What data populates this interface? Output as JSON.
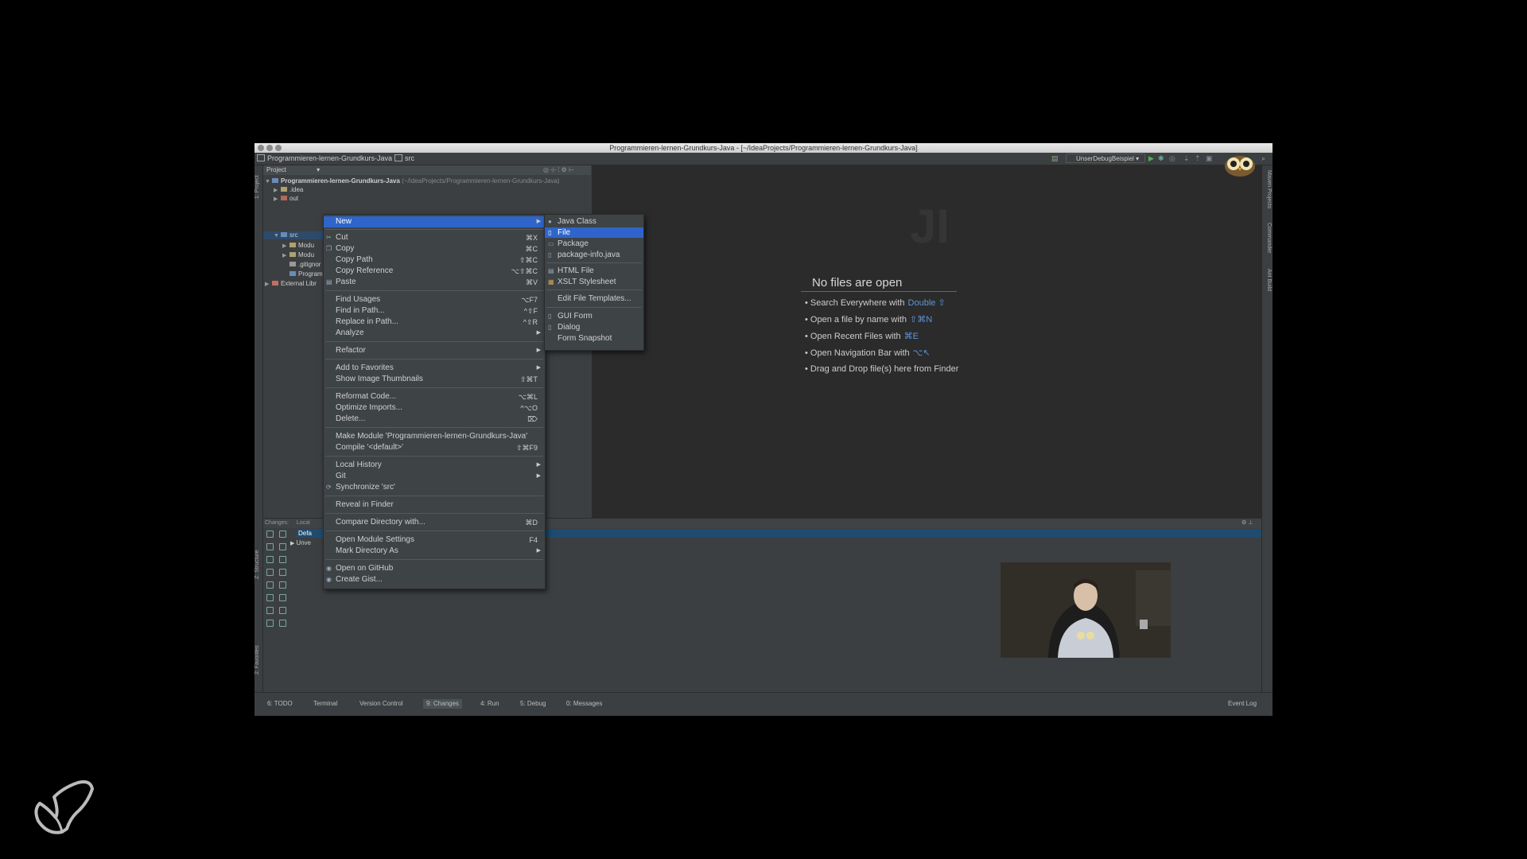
{
  "window": {
    "title": "Programmieren-lernen-Grundkurs-Java - [~/IdeaProjects/Programmieren-lernen-Grundkurs-Java]"
  },
  "navbar": {
    "project": "Programmieren-lernen-Grundkurs-Java",
    "folder": "src",
    "run_config": "UnserDebugBeispiel"
  },
  "left_strip": {
    "project_tab": "1: Project",
    "structure_tab": "Z: Structure",
    "favorites_tab": "2: Favorites"
  },
  "right_strip": {
    "maven": "Maven Projects",
    "commander": "Commander",
    "ant": "Ant Build"
  },
  "project_panel": {
    "header": "Project",
    "tree": [
      {
        "label": "Programmieren-lernen-Grundkurs-Java",
        "hint": "(~/IdeaProjects/Programmieren-lernen-Grundkurs-Java)"
      },
      {
        "label": ".idea"
      },
      {
        "label": "out"
      },
      {
        "label": "src"
      },
      {
        "label": "Modu"
      },
      {
        "label": "Modu"
      },
      {
        "label": ".gitignor"
      },
      {
        "label": "Program"
      },
      {
        "label": "External Libr"
      }
    ]
  },
  "editor": {
    "logo": "JI",
    "empty_title": "No files are open",
    "tips": [
      {
        "text": "Search Everywhere with",
        "key": "Double ⇧"
      },
      {
        "text": "Open a file by name with",
        "key": "⇧⌘N"
      },
      {
        "text": "Open Recent Files with",
        "key": "⌘E"
      },
      {
        "text": "Open Navigation Bar with",
        "key": "⌥↖"
      },
      {
        "text": "Drag and Drop file(s) here from Finder",
        "key": ""
      }
    ]
  },
  "bottom_panel": {
    "tab_changes": "Changes:",
    "tab_local": "Local",
    "row_default": "Defa",
    "row_unversioned": "Unve"
  },
  "context_menu": {
    "items": [
      {
        "label": "New",
        "shortcut": "",
        "submenu": true,
        "highlighted": true
      },
      {
        "label": "Cut",
        "shortcut": "⌘X",
        "icon": "cut-icon"
      },
      {
        "label": "Copy",
        "shortcut": "⌘C",
        "icon": "copy-icon"
      },
      {
        "label": "Copy Path",
        "shortcut": "⇧⌘C"
      },
      {
        "label": "Copy Reference",
        "shortcut": "⌥⇧⌘C"
      },
      {
        "label": "Paste",
        "shortcut": "⌘V",
        "icon": "paste-icon"
      },
      {
        "label": "Find Usages",
        "shortcut": "⌥F7"
      },
      {
        "label": "Find in Path...",
        "shortcut": "^⇧F"
      },
      {
        "label": "Replace in Path...",
        "shortcut": "^⇧R"
      },
      {
        "label": "Analyze",
        "submenu": true
      },
      {
        "label": "Refactor",
        "submenu": true
      },
      {
        "label": "Add to Favorites",
        "submenu": true
      },
      {
        "label": "Show Image Thumbnails",
        "shortcut": "⇧⌘T"
      },
      {
        "label": "Reformat Code...",
        "shortcut": "⌥⌘L"
      },
      {
        "label": "Optimize Imports...",
        "shortcut": "^⌥O"
      },
      {
        "label": "Delete...",
        "shortcut": "⌦"
      },
      {
        "label": "Make Module 'Programmieren-lernen-Grundkurs-Java'"
      },
      {
        "label": "Compile '<default>'",
        "shortcut": "⇧⌘F9"
      },
      {
        "label": "Local History",
        "submenu": true
      },
      {
        "label": "Git",
        "submenu": true
      },
      {
        "label": "Synchronize 'src'",
        "icon": "sync-icon"
      },
      {
        "label": "Reveal in Finder"
      },
      {
        "label": "Compare Directory with...",
        "shortcut": "⌘D"
      },
      {
        "label": "Open Module Settings",
        "shortcut": "F4"
      },
      {
        "label": "Mark Directory As",
        "submenu": true
      },
      {
        "label": "Open on GitHub",
        "icon": "github-icon"
      },
      {
        "label": "Create Gist...",
        "icon": "github-icon"
      }
    ]
  },
  "new_submenu": {
    "items": [
      {
        "label": "Java Class",
        "icon": "class-icon"
      },
      {
        "label": "File",
        "icon": "file-icon",
        "highlighted": true
      },
      {
        "label": "Package",
        "icon": "package-icon"
      },
      {
        "label": "package-info.java",
        "icon": "file-icon"
      },
      {
        "label": "HTML File",
        "icon": "html-icon"
      },
      {
        "label": "XSLT Stylesheet",
        "icon": "xslt-icon"
      },
      {
        "label": "Edit File Templates...",
        "icon": ""
      },
      {
        "label": "GUI Form",
        "icon": "form-icon"
      },
      {
        "label": "Dialog",
        "icon": "form-icon"
      },
      {
        "label": "Form Snapshot",
        "icon": ""
      }
    ]
  },
  "status_bar": {
    "tabs": [
      "6: TODO",
      "Terminal",
      "Version Control",
      "9: Changes",
      "4: Run",
      "5: Debug",
      "0: Messages"
    ],
    "event_log": "Event Log"
  },
  "colors": {
    "highlight": "#2f65ca",
    "editor_bg": "#2b2b2b",
    "panel_bg": "#3c3f41",
    "tip_key": "#5d95d8"
  }
}
